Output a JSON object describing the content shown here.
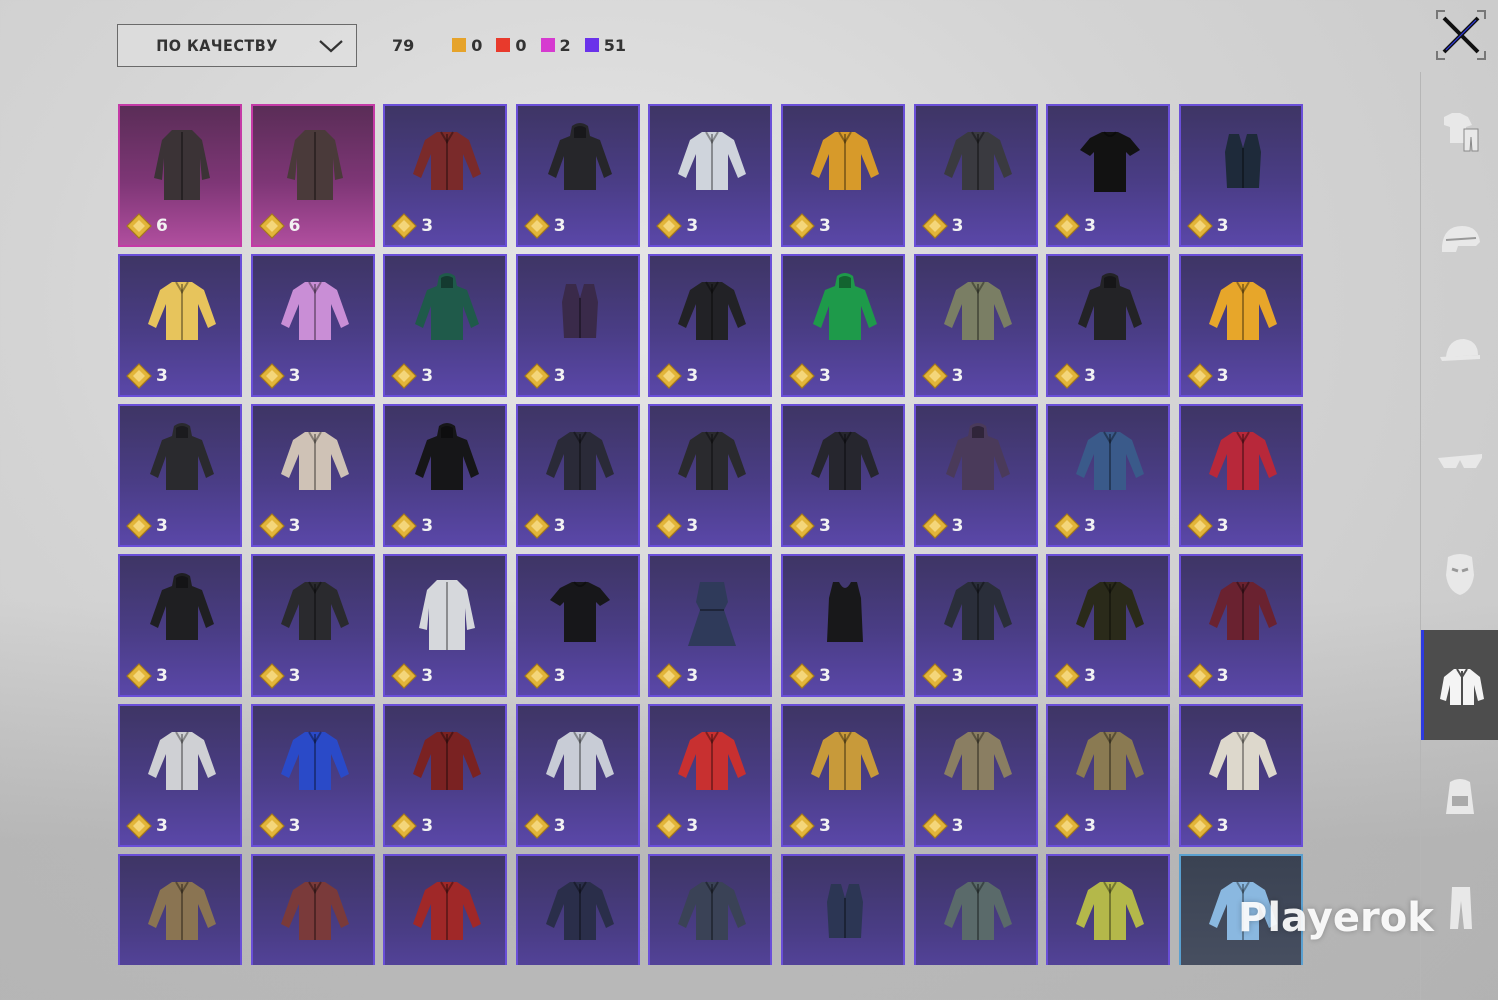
{
  "sort": {
    "label": "ПО КАЧЕСТВУ"
  },
  "stats": {
    "total": "79",
    "counts": [
      {
        "color": "#e6a32a",
        "value": "0"
      },
      {
        "color": "#e83a2c",
        "value": "0"
      },
      {
        "color": "#d63ad0",
        "value": "2"
      },
      {
        "color": "#6a32ea",
        "value": "51"
      }
    ]
  },
  "colors": {
    "purple_frame": "#6a4fd8",
    "pink_frame": "#c43aa6",
    "sidebar_active": "#4d4d4d",
    "active_marker": "#2d3adf"
  },
  "items": [
    {
      "count": "6",
      "q": "pink",
      "c": "#3b3336",
      "k": "coat"
    },
    {
      "count": "6",
      "q": "pink",
      "c": "#4a3a3a",
      "k": "coat"
    },
    {
      "count": "3",
      "q": "purple",
      "c": "#7a2a2a",
      "k": "jacket"
    },
    {
      "count": "3",
      "q": "purple",
      "c": "#26262a",
      "k": "hoodie"
    },
    {
      "count": "3",
      "q": "purple",
      "c": "#cfd4dc",
      "k": "jacket"
    },
    {
      "count": "3",
      "q": "purple",
      "c": "#d79a2a",
      "k": "jacket"
    },
    {
      "count": "3",
      "q": "purple",
      "c": "#3a3a40",
      "k": "jacket"
    },
    {
      "count": "3",
      "q": "purple",
      "c": "#121212",
      "k": "tshirt"
    },
    {
      "count": "3",
      "q": "purple",
      "c": "#1e2a3a",
      "k": "vest"
    },
    {
      "count": "3",
      "q": "purple",
      "c": "#e7c45c",
      "k": "jacket"
    },
    {
      "count": "3",
      "q": "purple",
      "c": "#c98ed6",
      "k": "jacket"
    },
    {
      "count": "3",
      "q": "purple",
      "c": "#1f5a4a",
      "k": "hoodie"
    },
    {
      "count": "3",
      "q": "purple",
      "c": "#3a2a4a",
      "k": "vest"
    },
    {
      "count": "3",
      "q": "purple",
      "c": "#222226",
      "k": "jacket"
    },
    {
      "count": "3",
      "q": "purple",
      "c": "#1e9a4a",
      "k": "hoodie"
    },
    {
      "count": "3",
      "q": "purple",
      "c": "#7a7e64",
      "k": "jacket"
    },
    {
      "count": "3",
      "q": "purple",
      "c": "#232326",
      "k": "hoodie"
    },
    {
      "count": "3",
      "q": "purple",
      "c": "#e7a62a",
      "k": "jacket"
    },
    {
      "count": "3",
      "q": "purple",
      "c": "#2a2a2e",
      "k": "hoodie"
    },
    {
      "count": "3",
      "q": "purple",
      "c": "#cfc2b6",
      "k": "jacket"
    },
    {
      "count": "3",
      "q": "purple",
      "c": "#161618",
      "k": "hoodie"
    },
    {
      "count": "3",
      "q": "purple",
      "c": "#2a2a38",
      "k": "jacket"
    },
    {
      "count": "3",
      "q": "purple",
      "c": "#2a2a2e",
      "k": "jacket"
    },
    {
      "count": "3",
      "q": "purple",
      "c": "#26262e",
      "k": "jacket"
    },
    {
      "count": "3",
      "q": "purple",
      "c": "#4a3a5a",
      "k": "hoodie"
    },
    {
      "count": "3",
      "q": "purple",
      "c": "#3a5a8a",
      "k": "jacket"
    },
    {
      "count": "3",
      "q": "purple",
      "c": "#b8283a",
      "k": "jacket"
    },
    {
      "count": "3",
      "q": "purple",
      "c": "#1f1f22",
      "k": "hoodie"
    },
    {
      "count": "3",
      "q": "purple",
      "c": "#2a2a2e",
      "k": "jacket"
    },
    {
      "count": "3",
      "q": "purple",
      "c": "#d6d8dc",
      "k": "coat"
    },
    {
      "count": "3",
      "q": "purple",
      "c": "#17171a",
      "k": "tshirt"
    },
    {
      "count": "3",
      "q": "purple",
      "c": "#2f3a5a",
      "k": "dress"
    },
    {
      "count": "3",
      "q": "purple",
      "c": "#18181a",
      "k": "tank"
    },
    {
      "count": "3",
      "q": "purple",
      "c": "#2a2e3a",
      "k": "jacket"
    },
    {
      "count": "3",
      "q": "purple",
      "c": "#2a2a1a",
      "k": "jacket"
    },
    {
      "count": "3",
      "q": "purple",
      "c": "#6a2230",
      "k": "jacket"
    },
    {
      "count": "3",
      "q": "purple",
      "c": "#cfd0d4",
      "k": "jacket"
    },
    {
      "count": "3",
      "q": "purple",
      "c": "#2a4ac8",
      "k": "jacket"
    },
    {
      "count": "3",
      "q": "purple",
      "c": "#7a2222",
      "k": "jacket"
    },
    {
      "count": "3",
      "q": "purple",
      "c": "#c8ccd6",
      "k": "jacket"
    },
    {
      "count": "3",
      "q": "purple",
      "c": "#c83030",
      "k": "jacket"
    },
    {
      "count": "3",
      "q": "purple",
      "c": "#c89a3a",
      "k": "jacket"
    },
    {
      "count": "3",
      "q": "purple",
      "c": "#8a7e62",
      "k": "jacket"
    },
    {
      "count": "3",
      "q": "purple",
      "c": "#8a7a52",
      "k": "jacket"
    },
    {
      "count": "3",
      "q": "purple",
      "c": "#ddd8cc",
      "k": "jacket"
    },
    {
      "count": "",
      "q": "purple",
      "c": "#8a7452",
      "k": "jacket"
    },
    {
      "count": "",
      "q": "purple",
      "c": "#7a3a3a",
      "k": "jacket"
    },
    {
      "count": "",
      "q": "purple",
      "c": "#a02828",
      "k": "jacket"
    },
    {
      "count": "",
      "q": "purple",
      "c": "#2a2e4a",
      "k": "jacket"
    },
    {
      "count": "",
      "q": "purple",
      "c": "#3a4256",
      "k": "jacket"
    },
    {
      "count": "",
      "q": "purple",
      "c": "#2c3654",
      "k": "vest"
    },
    {
      "count": "",
      "q": "purple",
      "c": "#5a6a6a",
      "k": "jacket"
    },
    {
      "count": "",
      "q": "purple",
      "c": "#b4b84a",
      "k": "jacket"
    },
    {
      "count": "",
      "q": "sel",
      "c": "#8ab8e0",
      "k": "jacket"
    }
  ],
  "sidebar": [
    {
      "icon": "outfit-icon",
      "label": "outfit"
    },
    {
      "icon": "helmet-icon",
      "label": "helmet"
    },
    {
      "icon": "cap-icon",
      "label": "cap"
    },
    {
      "icon": "glasses-icon",
      "label": "glasses"
    },
    {
      "icon": "mask-icon",
      "label": "mask"
    },
    {
      "icon": "jacket-icon",
      "label": "jacket",
      "active": true
    },
    {
      "icon": "backpack-icon",
      "label": "backpack"
    },
    {
      "icon": "pants-icon",
      "label": "pants"
    }
  ],
  "watermark": "Playerok"
}
